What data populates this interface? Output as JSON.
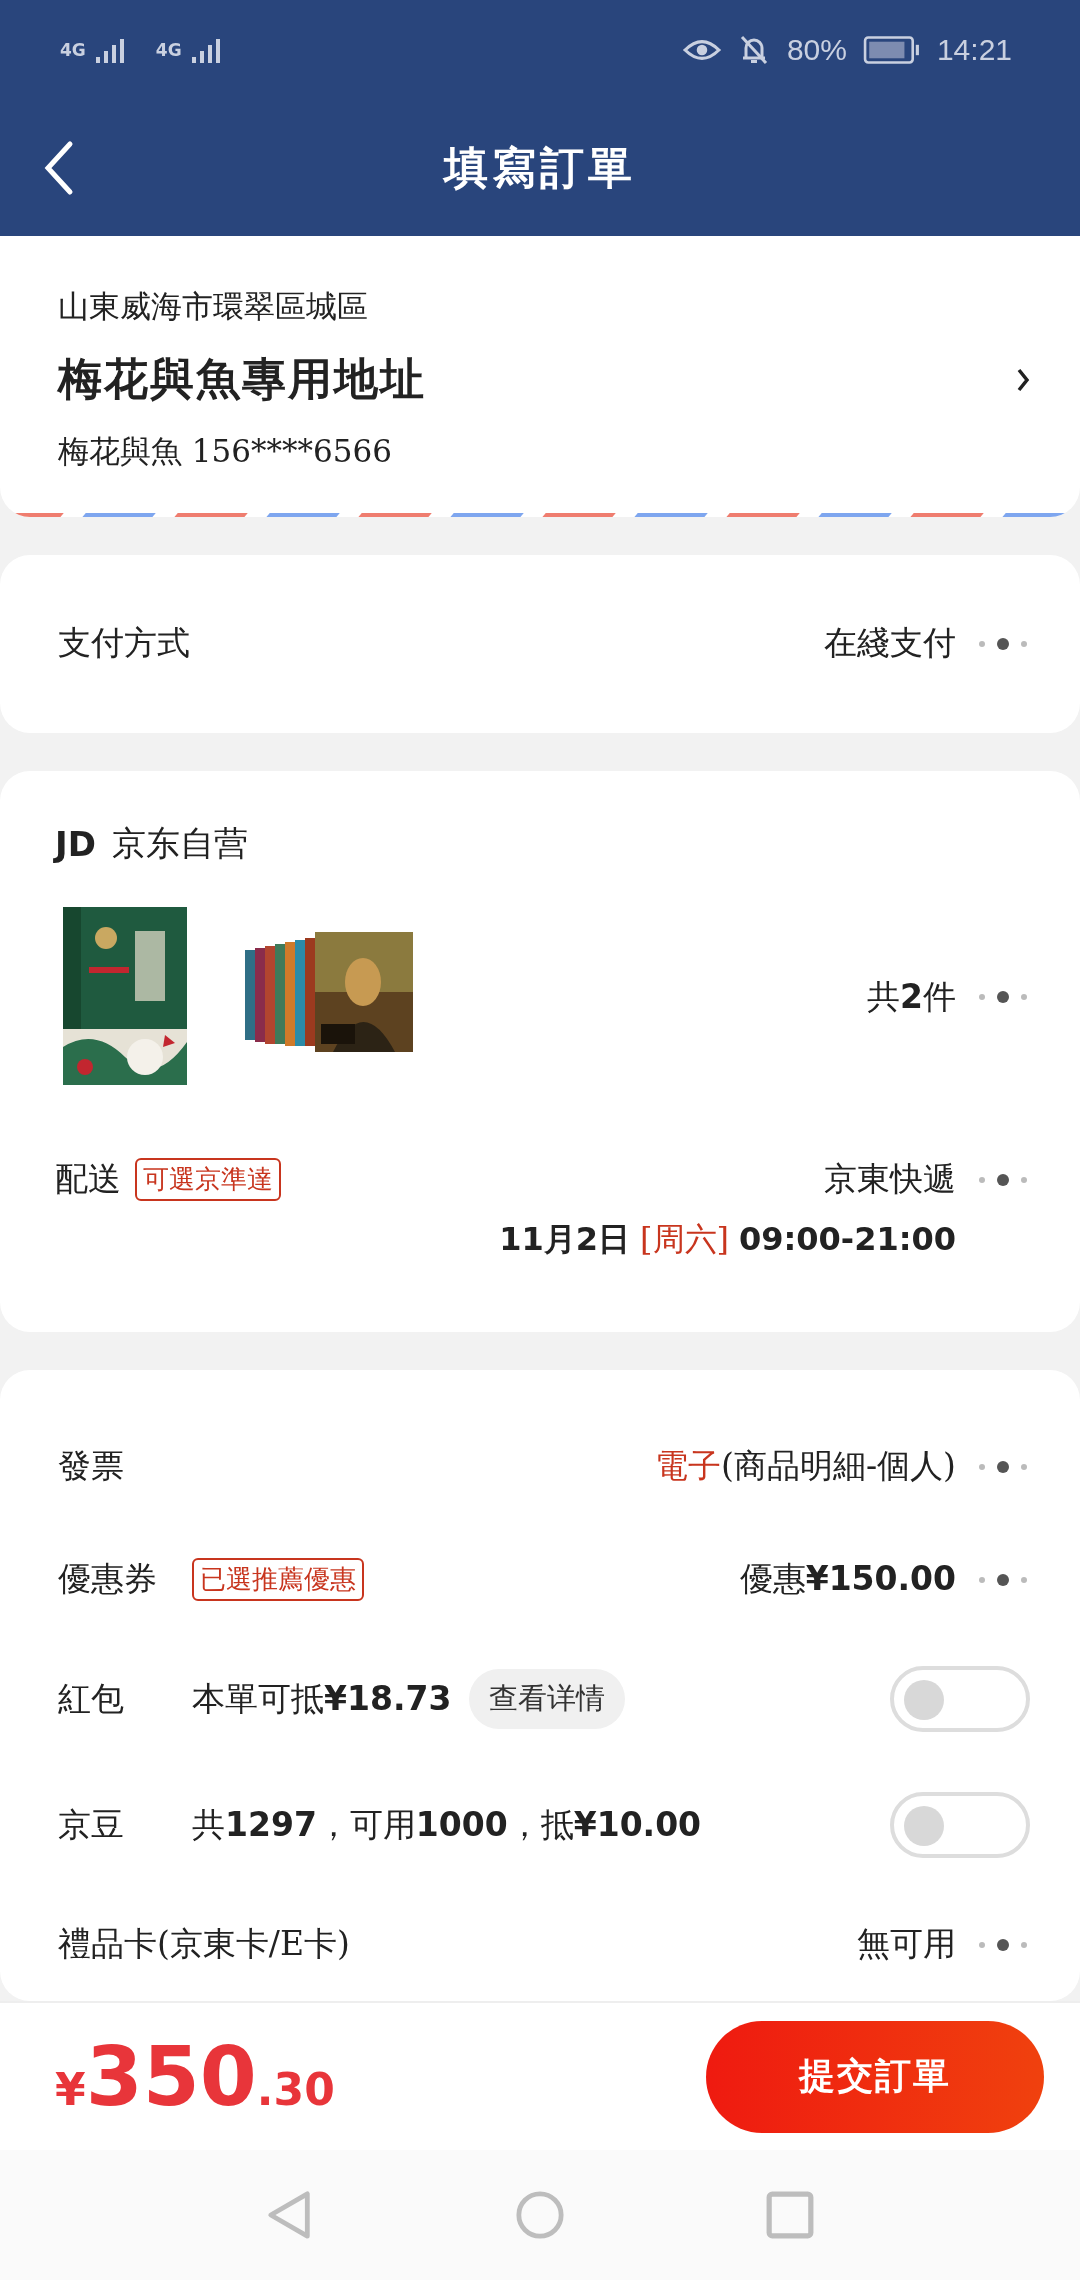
{
  "status_bar": {
    "network_1": "4G",
    "network_2": "4G",
    "battery": "80%",
    "time": "14:21"
  },
  "nav": {
    "title": "填寫訂單"
  },
  "address": {
    "region": "山東威海市環翠區城區",
    "title": "梅花與魚專用地址",
    "contact": "梅花與魚 156****6566"
  },
  "payment": {
    "label": "支付方式",
    "value": "在綫支付"
  },
  "shop": {
    "logo": "JD",
    "name": "京东自营",
    "count": "共**2**件"
  },
  "delivery": {
    "label": "配送",
    "tag": "可選京準達",
    "method": "京東快遞",
    "date": "11月2日",
    "weekday": "[周六]",
    "time": "09:00-21:00"
  },
  "options": [
    {
      "kind": "link",
      "label": "發票",
      "highlight": "電子",
      "value": "(商品明細-個人)"
    },
    {
      "kind": "link",
      "label": "優惠券",
      "tag": "已選推薦優惠",
      "value": "優惠**¥150.00**"
    },
    {
      "kind": "toggle",
      "label": "紅包",
      "detail": "本單可抵**¥18.73**",
      "button": "查看详情",
      "on": false
    },
    {
      "kind": "toggle",
      "label": "京豆",
      "detail": "共**1297**，可用**1000**，抵**¥10.00**",
      "on": false
    },
    {
      "kind": "link",
      "label": "禮品卡(京東卡/E卡)",
      "value": "無可用"
    }
  ],
  "footer": {
    "currency": "¥",
    "amount": "350",
    "decimals": ".30",
    "submit": "提交訂單"
  }
}
